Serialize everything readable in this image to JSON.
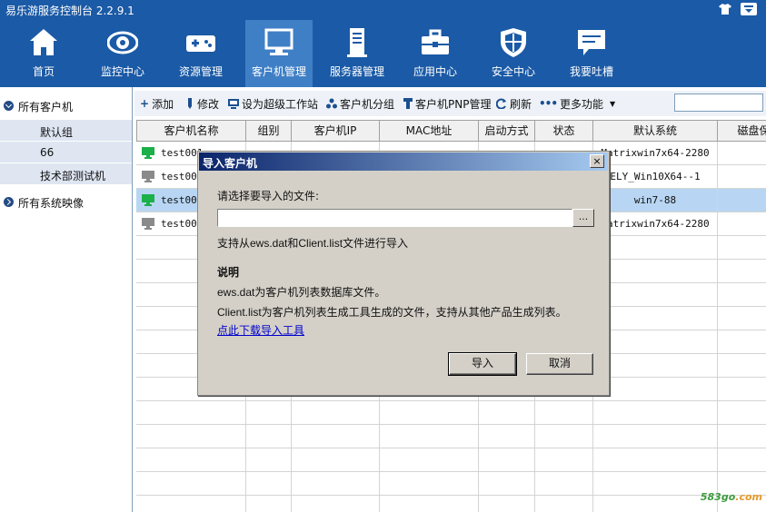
{
  "app": {
    "title": "易乐游服务控制台 2.2.9.1"
  },
  "nav": [
    {
      "label": "首页",
      "icon": "home-icon"
    },
    {
      "label": "监控中心",
      "icon": "eye-icon"
    },
    {
      "label": "资源管理",
      "icon": "gamepad-icon"
    },
    {
      "label": "客户机管理",
      "icon": "monitor-icon",
      "active": true
    },
    {
      "label": "服务器管理",
      "icon": "server-icon"
    },
    {
      "label": "应用中心",
      "icon": "toolbox-icon"
    },
    {
      "label": "安全中心",
      "icon": "shield-icon"
    },
    {
      "label": "我要吐槽",
      "icon": "chat-icon"
    }
  ],
  "sidebar": {
    "all_clients": "所有客户机",
    "groups": [
      "默认组",
      "66",
      "技术部测试机"
    ],
    "all_images": "所有系统映像"
  },
  "toolbar": {
    "add": "添加",
    "edit": "修改",
    "super_ws": "设为超级工作站",
    "group": "客户机分组",
    "pnp": "客户机PNP管理",
    "refresh": "刷新",
    "more": "更多功能",
    "search_value": ""
  },
  "grid": {
    "columns": [
      "客户机名称",
      "组别",
      "客户机IP",
      "MAC地址",
      "启动方式",
      "状态",
      "默认系统",
      "磁盘保"
    ],
    "rows": [
      {
        "name": "test001",
        "system": "Matrixwin7x64-2280",
        "online": true
      },
      {
        "name": "test002",
        "system": "ELY_Win10X64--1",
        "online": false
      },
      {
        "name": "test003",
        "system": "win7-88",
        "online": true,
        "selected": true
      },
      {
        "name": "test004",
        "system": "Matrixwin7x64-2280",
        "online": false
      }
    ]
  },
  "dialog": {
    "title": "导入客户机",
    "close": "×",
    "prompt": "请选择要导入的文件:",
    "file_value": "",
    "browse": "...",
    "support": "支持从ews.dat和Client.list文件进行导入",
    "heading": "说明",
    "desc1": "ews.dat为客户机列表数据库文件。",
    "desc2": "Client.list为客户机列表生成工具生成的文件，支持从其他产品生成列表。",
    "link": "点此下载导入工具",
    "import_btn": "导入",
    "cancel_btn": "取消"
  },
  "watermark": {
    "prefix": "583go",
    "suffix": ".com"
  },
  "colors": {
    "topbar": "#1b5aa6",
    "nav_active": "#3f7fc6",
    "selected_row": "#b8d6f3",
    "online": "#1bb04a",
    "offline": "#8a8a8a"
  }
}
